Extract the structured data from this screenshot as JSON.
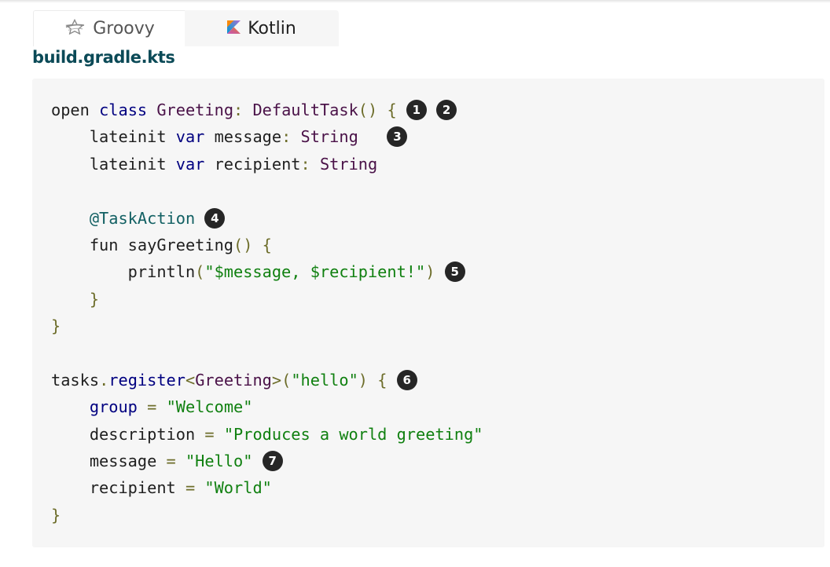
{
  "tabs": [
    {
      "label": "Groovy",
      "icon": "groovy-star-icon",
      "active": false
    },
    {
      "label": "Kotlin",
      "icon": "kotlin-logo-icon",
      "active": true
    }
  ],
  "file_name": "build.gradle.kts",
  "colors": {
    "keyword": "#000080",
    "type": "#4a1248",
    "string": "#108010",
    "annotation": "#126063",
    "punctuation": "#6d6d2a",
    "callout_bg": "#262626",
    "file_name": "#0b4a57",
    "code_bg": "#f6f6f6"
  },
  "code": {
    "lines": [
      [
        {
          "t": "open "
        },
        {
          "t": "class",
          "c": "kw"
        },
        {
          "t": " "
        },
        {
          "t": "Greeting",
          "c": "typ"
        },
        {
          "t": ":",
          "c": "pun"
        },
        {
          "t": " "
        },
        {
          "t": "DefaultTask",
          "c": "typ"
        },
        {
          "t": "()",
          "c": "pun"
        },
        {
          "t": " "
        },
        {
          "t": "{",
          "c": "pun"
        },
        {
          "t": " "
        },
        {
          "callout": "1"
        },
        {
          "t": " "
        },
        {
          "callout": "2"
        }
      ],
      [
        {
          "t": "    lateinit "
        },
        {
          "t": "var",
          "c": "kw"
        },
        {
          "t": " message"
        },
        {
          "t": ":",
          "c": "pun"
        },
        {
          "t": " "
        },
        {
          "t": "String",
          "c": "typ"
        },
        {
          "t": "   "
        },
        {
          "callout": "3"
        }
      ],
      [
        {
          "t": "    lateinit "
        },
        {
          "t": "var",
          "c": "kw"
        },
        {
          "t": " recipient"
        },
        {
          "t": ":",
          "c": "pun"
        },
        {
          "t": " "
        },
        {
          "t": "String",
          "c": "typ"
        }
      ],
      [],
      [
        {
          "t": "    "
        },
        {
          "t": "@TaskAction",
          "c": "ann"
        },
        {
          "t": " "
        },
        {
          "callout": "4"
        }
      ],
      [
        {
          "t": "    fun sayGreeting"
        },
        {
          "t": "()",
          "c": "pun"
        },
        {
          "t": " "
        },
        {
          "t": "{",
          "c": "pun"
        }
      ],
      [
        {
          "t": "        println"
        },
        {
          "t": "(",
          "c": "pun"
        },
        {
          "t": "\"$message, $recipient!\"",
          "c": "str"
        },
        {
          "t": ")",
          "c": "pun"
        },
        {
          "t": " "
        },
        {
          "callout": "5"
        }
      ],
      [
        {
          "t": "    "
        },
        {
          "t": "}",
          "c": "pun"
        }
      ],
      [
        {
          "t": "}",
          "c": "pun"
        }
      ],
      [],
      [
        {
          "t": "tasks"
        },
        {
          "t": ".",
          "c": "pun"
        },
        {
          "t": "register",
          "c": "kw"
        },
        {
          "t": "<",
          "c": "pun"
        },
        {
          "t": "Greeting",
          "c": "typ"
        },
        {
          "t": ">",
          "c": "pun"
        },
        {
          "t": "(",
          "c": "pun"
        },
        {
          "t": "\"hello\"",
          "c": "str"
        },
        {
          "t": ")",
          "c": "pun"
        },
        {
          "t": " "
        },
        {
          "t": "{",
          "c": "pun"
        },
        {
          "t": " "
        },
        {
          "callout": "6"
        }
      ],
      [
        {
          "t": "    "
        },
        {
          "t": "group",
          "c": "kw"
        },
        {
          "t": " "
        },
        {
          "t": "=",
          "c": "pun"
        },
        {
          "t": " "
        },
        {
          "t": "\"Welcome\"",
          "c": "str"
        }
      ],
      [
        {
          "t": "    description "
        },
        {
          "t": "=",
          "c": "pun"
        },
        {
          "t": " "
        },
        {
          "t": "\"Produces a world greeting\"",
          "c": "str"
        }
      ],
      [
        {
          "t": "    message "
        },
        {
          "t": "=",
          "c": "pun"
        },
        {
          "t": " "
        },
        {
          "t": "\"Hello\"",
          "c": "str"
        },
        {
          "t": " "
        },
        {
          "callout": "7"
        }
      ],
      [
        {
          "t": "    recipient "
        },
        {
          "t": "=",
          "c": "pun"
        },
        {
          "t": " "
        },
        {
          "t": "\"World\"",
          "c": "str"
        }
      ],
      [
        {
          "t": "}",
          "c": "pun"
        }
      ]
    ]
  }
}
